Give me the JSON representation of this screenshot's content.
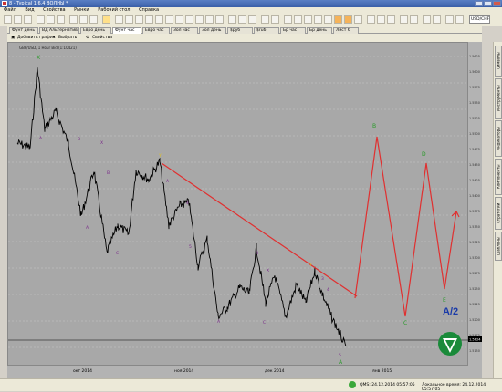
{
  "window": {
    "title": "8 - Typical 1.6.4 ВОЛНЫ *"
  },
  "menu": [
    "Файл",
    "Вид",
    "Свойства",
    "Рынки",
    "Рабочий стол",
    "Справка"
  ],
  "toolbar": {
    "symbol": "USD/CHF"
  },
  "tabs": [
    "Фунт день",
    "ВД Альтернатива",
    "Евро день",
    "Фунт час",
    "Евро час",
    "Зол час",
    "Зол день",
    "$руб",
    "$ruб",
    "Бр час",
    "Бр день",
    "Лист 6"
  ],
  "active_tab_index": 3,
  "chart_toolbar": {
    "add_chart": "Добавить график",
    "select": "Выбрать",
    "properties": "Свойства"
  },
  "chart": {
    "info": "GBP/USD, 1 Hour Bid (1:10421)",
    "time_labels": [
      "окт 2014",
      "ноя 2014",
      "дек 2014",
      "янв 2015"
    ],
    "last_price": "1.5624",
    "logo_text": "A/2",
    "wave_labels": [
      "X",
      "A",
      "B",
      "X",
      "A",
      "B",
      "Y",
      "A",
      "C",
      "4",
      "5",
      "B",
      "X",
      "A",
      "C",
      "Y",
      "3",
      "4",
      "5",
      "A",
      "B",
      "C",
      "D",
      "E"
    ],
    "price_ticks": [
      "1.5625",
      "1.5600",
      "1.5575",
      "1.5550",
      "1.5525",
      "1.5500",
      "1.5475",
      "1.5450",
      "1.5425",
      "1.5400",
      "1.5375",
      "1.5350",
      "1.5325",
      "1.5300",
      "1.5275",
      "1.5250",
      "1.5225",
      "1.5200",
      "1.5175",
      "1.5150"
    ]
  },
  "side_tabs": [
    "Символы",
    "Инструменты",
    "Индикаторы",
    "Компоненты",
    "Стратегии",
    "Шаблоны"
  ],
  "status": {
    "left": "QMS: 24.12.2014 05:57:05",
    "right": "Локальное время: 24.12.2014 05:57:05"
  },
  "colors": {
    "trendline": "#e03030",
    "wave_green": "#2a9a2a",
    "wave_purple": "#7a2a8a",
    "wave_yellow": "#e0c020",
    "accent_blue": "#1a3aa8"
  }
}
